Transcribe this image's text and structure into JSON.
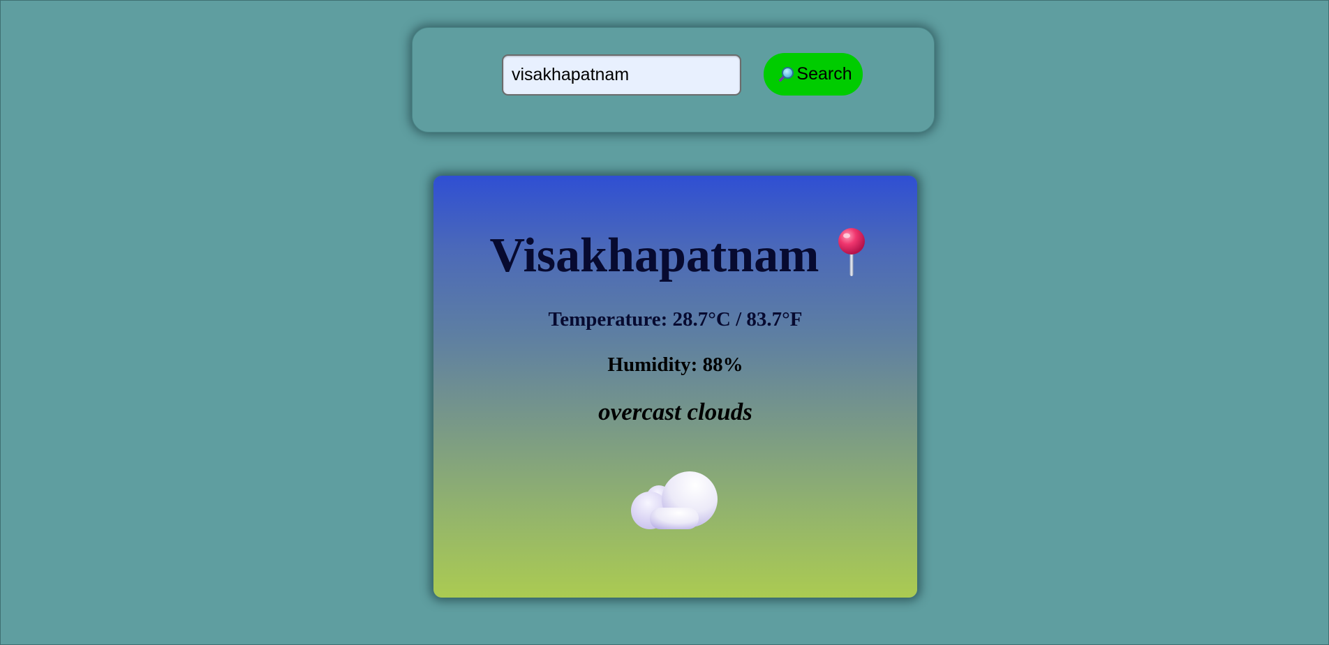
{
  "search": {
    "value": "visakhapatnam",
    "button_label": "Search",
    "button_icon": "magnifying-glass-icon",
    "button_color": "#00cc00"
  },
  "weather": {
    "city": "Visakhapatnam",
    "city_icon": "round-pushpin-icon",
    "temperature_text": "Temperature: 28.7°C / 83.7°F",
    "humidity_text": "Humidity: 88%",
    "condition": "overcast clouds",
    "condition_icon": "cloud-icon"
  },
  "colors": {
    "page_background": "#5f9ea0",
    "card_gradient_top": "#2f4fd3",
    "card_gradient_bottom": "#abcb52",
    "text": "#070a30"
  }
}
